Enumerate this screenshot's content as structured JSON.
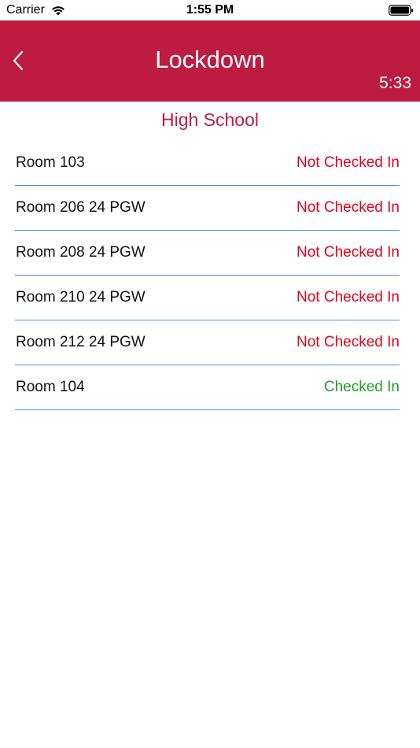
{
  "status_bar": {
    "carrier": "Carrier",
    "time": "1:55 PM",
    "wifi_icon": "wifi-icon",
    "battery_icon": "battery-icon"
  },
  "header": {
    "title": "Lockdown",
    "timer": "5:33",
    "back_icon": "chevron-left-icon",
    "color": "#bd1c40"
  },
  "subtitle": "High School",
  "rooms": [
    {
      "name": "Room 103",
      "status": "Not Checked In",
      "checked": false
    },
    {
      "name": "Room 206 24 PGW",
      "status": "Not Checked In",
      "checked": false
    },
    {
      "name": "Room 208 24 PGW",
      "status": "Not Checked In",
      "checked": false
    },
    {
      "name": "Room 210 24 PGW",
      "status": "Not Checked In",
      "checked": false
    },
    {
      "name": "Room 212 24 PGW",
      "status": "Not Checked In",
      "checked": false
    },
    {
      "name": "Room 104",
      "status": "Checked In",
      "checked": true
    }
  ],
  "colors": {
    "not_checked_in": "#e8001c",
    "checked_in": "#1fa21f",
    "divider": "#4a90d9"
  }
}
